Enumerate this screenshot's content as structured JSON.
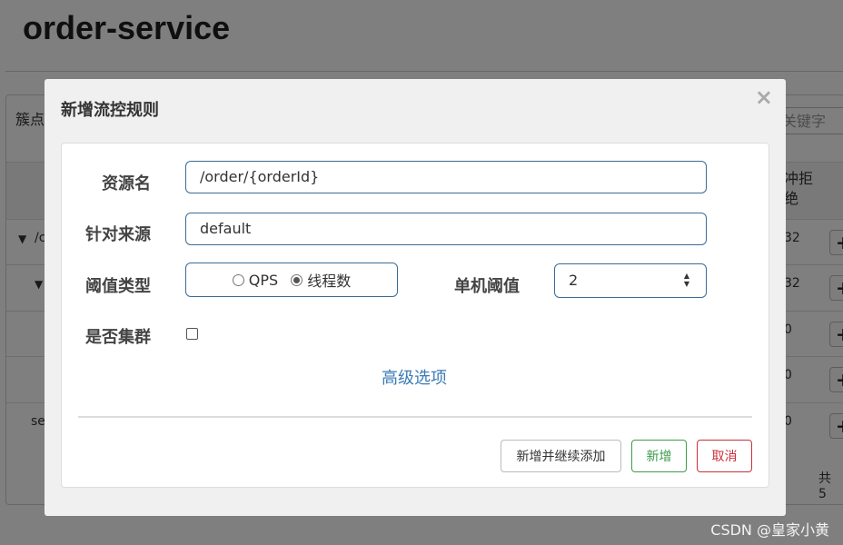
{
  "page": {
    "title": "order-service"
  },
  "background": {
    "filter_label": "簇点",
    "search_placeholder": "关键字",
    "head_col": "冲拒\n绝",
    "rows": [
      {
        "label": "/c",
        "value": "32"
      },
      {
        "label": "",
        "value": "32"
      },
      {
        "label": "",
        "value": "0"
      },
      {
        "label": "",
        "value": "0"
      },
      {
        "label": "se",
        "value": "0"
      }
    ],
    "expand_icons": [
      "▼",
      "▼"
    ],
    "row_button_label": "+",
    "footer": "共 5"
  },
  "modal": {
    "title": "新增流控规则",
    "close_label": "×",
    "fields": {
      "resource_label": "资源名",
      "resource_value": "/order/{orderId}",
      "origin_label": "针对来源",
      "origin_value": "default",
      "threshold_type_label": "阈值类型",
      "option_qps": "QPS",
      "option_threads": "线程数",
      "selected_option": "线程数",
      "single_threshold_label": "单机阈值",
      "single_threshold_value": "2",
      "cluster_label": "是否集群"
    },
    "advanced_link": "高级选项",
    "buttons": {
      "add_continue": "新增并继续添加",
      "add": "新增",
      "cancel": "取消"
    }
  },
  "watermark": "CSDN @皇家小黄",
  "colors": {
    "accent": "#3b6c96",
    "link": "#3b7bb5",
    "success": "#3c9a4a",
    "danger": "#c9303a"
  }
}
